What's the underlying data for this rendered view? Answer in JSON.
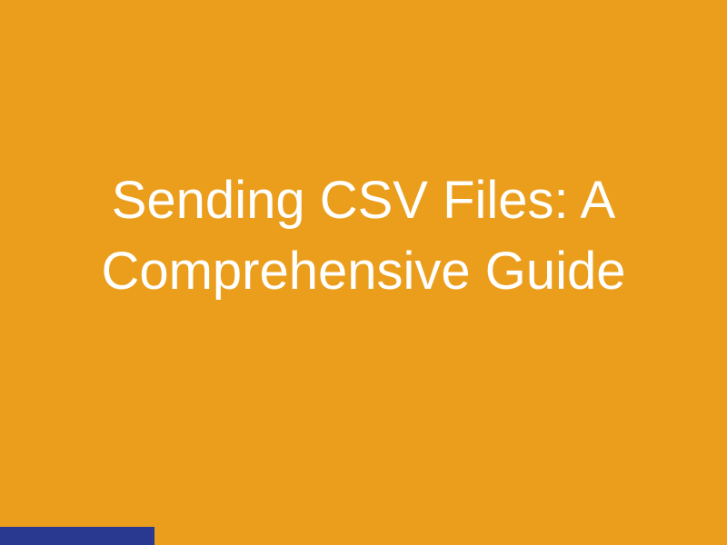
{
  "heading": "Sending CSV Files: A Comprehensive Guide"
}
